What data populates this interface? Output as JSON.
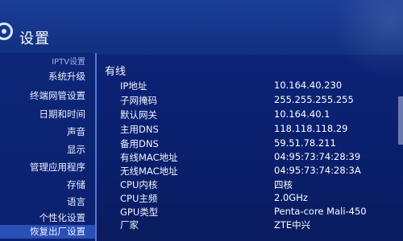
{
  "header": {
    "title": "设置"
  },
  "sidebar": {
    "items": [
      {
        "label": "IPTV设置"
      },
      {
        "label": "系统升级"
      },
      {
        "label": "终端网管设置"
      },
      {
        "label": "日期和时间"
      },
      {
        "label": "声音"
      },
      {
        "label": "显示"
      },
      {
        "label": "管理应用程序"
      },
      {
        "label": "存储"
      },
      {
        "label": "语言"
      },
      {
        "label": "个性化设置"
      },
      {
        "label": "恢复出厂设置"
      }
    ]
  },
  "main": {
    "section_title": "有线",
    "rows": [
      {
        "label": "IP地址",
        "value": "10.164.40.230"
      },
      {
        "label": "子网掩码",
        "value": "255.255.255.255"
      },
      {
        "label": "默认网关",
        "value": "10.164.40.1"
      },
      {
        "label": "主用DNS",
        "value": "118.118.118.29"
      },
      {
        "label": "备用DNS",
        "value": "59.51.78.211"
      },
      {
        "label": "有线MAC地址",
        "value": "04:95:73:74:28:39"
      },
      {
        "label": "无线MAC地址",
        "value": "04:95:73:74:28:3A"
      },
      {
        "label": "CPU内核",
        "value": "四核"
      },
      {
        "label": "CPU主频",
        "value": "2.0GHz"
      },
      {
        "label": "GPU类型",
        "value": "Penta-core Mali-450"
      },
      {
        "label": "厂家",
        "value": "ZTE中兴"
      }
    ]
  },
  "colors": {
    "background": "#0b2274",
    "sidebar_selected": "#2a4fb7",
    "divider": "#5576cf",
    "text": "#ffffff"
  }
}
